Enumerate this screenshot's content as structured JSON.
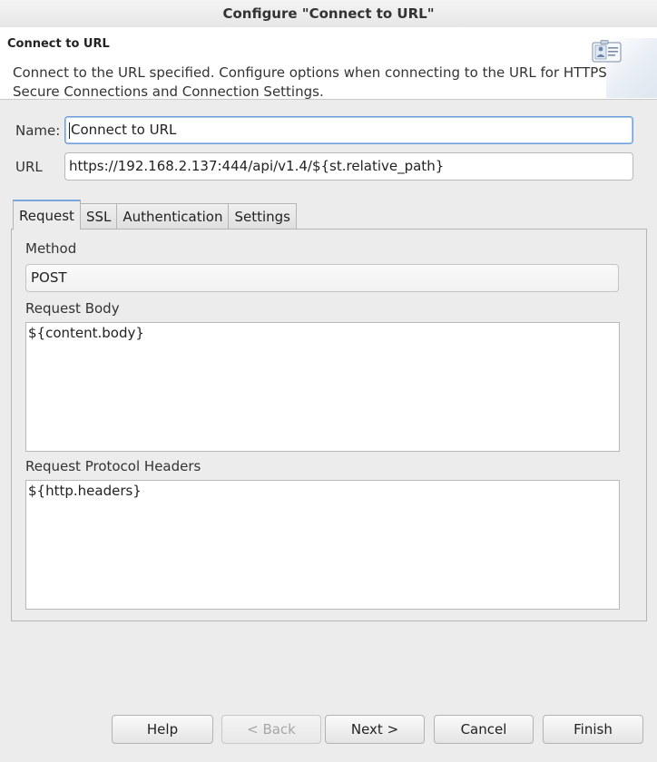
{
  "window": {
    "title": "Configure \"Connect to URL\""
  },
  "banner": {
    "title": "Connect to URL",
    "description": "Connect to the URL specified.  Configure options when connecting to the URL for HTTPS, Secure Connections and Connection Settings.",
    "icon": "properties-dialog-icon"
  },
  "form": {
    "name_label": "Name:",
    "name_value": "Connect to URL",
    "url_label": "URL",
    "url_value": "https://192.168.2.137:444/api/v1.4/${st.relative_path}"
  },
  "tabs": [
    {
      "label": "Request",
      "active": true
    },
    {
      "label": "SSL",
      "active": false
    },
    {
      "label": "Authentication",
      "active": false
    },
    {
      "label": "Settings",
      "active": false
    }
  ],
  "request": {
    "method_label": "Method",
    "method_value": "POST",
    "body_label": "Request Body",
    "body_value": "${content.body}",
    "headers_label": "Request Protocol Headers",
    "headers_value": "${http.headers}"
  },
  "buttons": {
    "help": "Help",
    "back": "< Back",
    "next": "Next >",
    "cancel": "Cancel",
    "finish": "Finish"
  }
}
